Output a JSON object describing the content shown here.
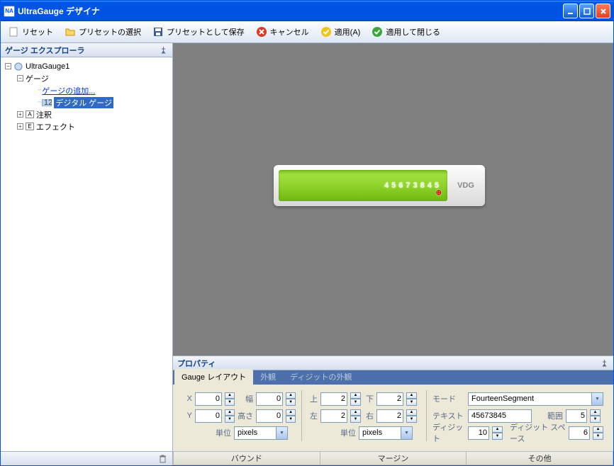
{
  "window": {
    "title": "UltraGauge デザイナ"
  },
  "toolbar": {
    "reset": "リセット",
    "select_preset": "プリセットの選択",
    "save_preset": "プリセットとして保存",
    "cancel": "キャンセル",
    "apply": "適用(A)",
    "apply_close": "適用して閉じる"
  },
  "explorer": {
    "title": "ゲージ エクスプローラ",
    "root": "UltraGauge1",
    "gauges": "ゲージ",
    "add_gauge": "ゲージの追加...",
    "digital_gauge": "デジタル ゲージ",
    "annotation": "注釈",
    "effects": "エフェクト"
  },
  "gauge": {
    "digits": "45673845",
    "badge": "VDG"
  },
  "properties": {
    "title": "プロパティ",
    "tabs": {
      "layout": "Gauge レイアウト",
      "appearance": "外観",
      "digit_appearance": "ディジットの外観"
    },
    "bounds": {
      "x_label": "X",
      "x_value": "0",
      "y_label": "Y",
      "y_value": "0",
      "w_label": "幅",
      "w_value": "0",
      "h_label": "高さ",
      "h_value": "0",
      "unit_label": "単位",
      "unit_value": "pixels"
    },
    "margin": {
      "top_label": "上",
      "top_value": "2",
      "bottom_label": "下",
      "bottom_value": "2",
      "left_label": "左",
      "left_value": "2",
      "right_label": "右",
      "right_value": "2",
      "unit_label": "単位",
      "unit_value": "pixels"
    },
    "misc": {
      "mode_label": "モード",
      "mode_value": "FourteenSegment",
      "text_label": "テキスト",
      "text_value": "45673845",
      "range_label": "範囲",
      "range_value": "5",
      "digit_label": "ディジット",
      "digit_value": "10",
      "digitspace_label": "ディジット スペース",
      "digitspace_value": "6"
    },
    "section_bounds": "バウンド",
    "section_margin": "マージン",
    "section_misc": "その他"
  }
}
